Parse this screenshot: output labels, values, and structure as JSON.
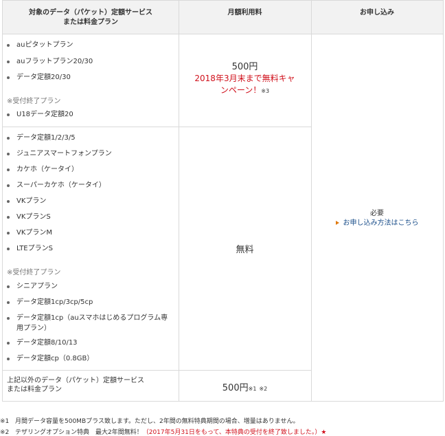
{
  "headers": {
    "col1_line1": "対象のデータ（パケット）定額サービス",
    "col1_line2": "または料金プラン",
    "col2": "月額利用料",
    "col3": "お申し込み"
  },
  "group1": {
    "items": [
      "auピタットプラン",
      "auフラットプラン20/30",
      "データ定額20/30"
    ],
    "closed_note": "※受付終了プラン",
    "closed_items": [
      "U18データ定額20"
    ],
    "price": "500円",
    "campaign_line1": "2018年3月末まで無料キャ",
    "campaign_line2": "ンペーン！",
    "campaign_mark": "※3"
  },
  "group2": {
    "items": [
      "データ定額1/2/3/5",
      "ジュニアスマートフォンプラン",
      "カケホ（ケータイ）",
      "スーパーカケホ（ケータイ）",
      "VKプラン",
      "VKプランS",
      "VKプランM",
      "LTEプランS"
    ],
    "closed_note": "※受付終了プラン",
    "closed_items": [
      "シニアプラン",
      "データ定額1cp/3cp/5cp"
    ],
    "long_item_line1": "データ定額1cp（auスマホはじめるプログラム専",
    "long_item_line2": "用プラン）",
    "closed_items_after": [
      "データ定額8/10/13",
      "データ定額cp（0.8GB）"
    ],
    "price": "無料"
  },
  "group3": {
    "label_line1": "上記以外のデータ（パケット）定額サービス",
    "label_line2": "または料金プラン",
    "price": "500円",
    "mark1": "※1",
    "mark2": "※2"
  },
  "apply": {
    "required": "必要",
    "link": "お申し込み方法はこちら"
  },
  "footnotes": {
    "n1_mark": "※1",
    "n1_text": "月間データ容量を500MBプラス致します。ただし、2年間の無料特典期間の場合、増量はありません。",
    "n2_mark": "※2",
    "n2_text": "テザリングオプション特典　最大2年間無料！",
    "n2_red": "（2017年5月31日をもって、本特典の受付を終了致しました。）★"
  },
  "colors": {
    "accent_red": "#d0101b",
    "link": "#1a4e8a",
    "arrow": "#e07a0f",
    "header_bg": "#f2f2f2",
    "border": "#d9d9d9"
  }
}
